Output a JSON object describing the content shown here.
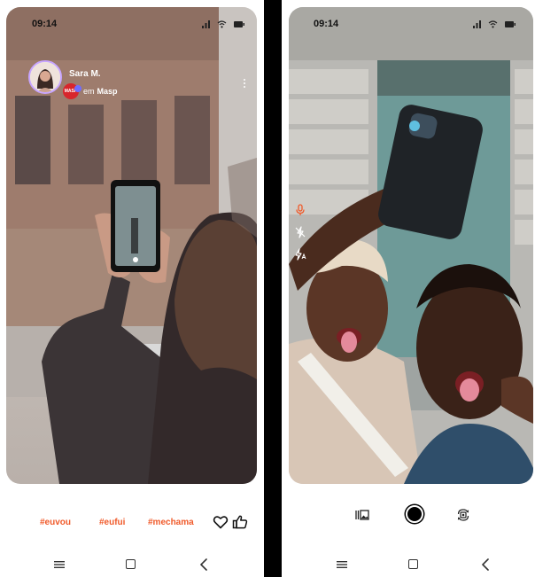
{
  "left_screen": {
    "status_bar": {
      "time": "09:14"
    },
    "post": {
      "author_name": "Sara M.",
      "place_prefix": "em",
      "place_name": "Masp",
      "place_badge": "MASP"
    },
    "hashtags": [
      "#euvou",
      "#eufui",
      "#mechama"
    ]
  },
  "right_screen": {
    "status_bar": {
      "time": "09:14"
    }
  },
  "icons": {
    "signal": "signal-icon",
    "wifi": "wifi-icon",
    "battery": "battery-icon",
    "more": "more-vertical-icon",
    "like": "heart-icon",
    "thumb": "thumbs-up-icon",
    "gallery": "gallery-icon",
    "shutter": "shutter-icon",
    "flip": "flip-camera-icon",
    "nav_menu": "menu-icon",
    "nav_home": "home-square-icon",
    "nav_back": "back-chevron-icon",
    "mic": "mic-icon",
    "flash_off": "flash-off-icon",
    "flash_auto": "flash-auto-icon"
  },
  "colors": {
    "hashtag": "#f05a2a",
    "badge_red": "#d8262c",
    "avatar_ring": "#c7a5ff",
    "tool_orange": "#f05a2a",
    "divider": "#000000"
  }
}
